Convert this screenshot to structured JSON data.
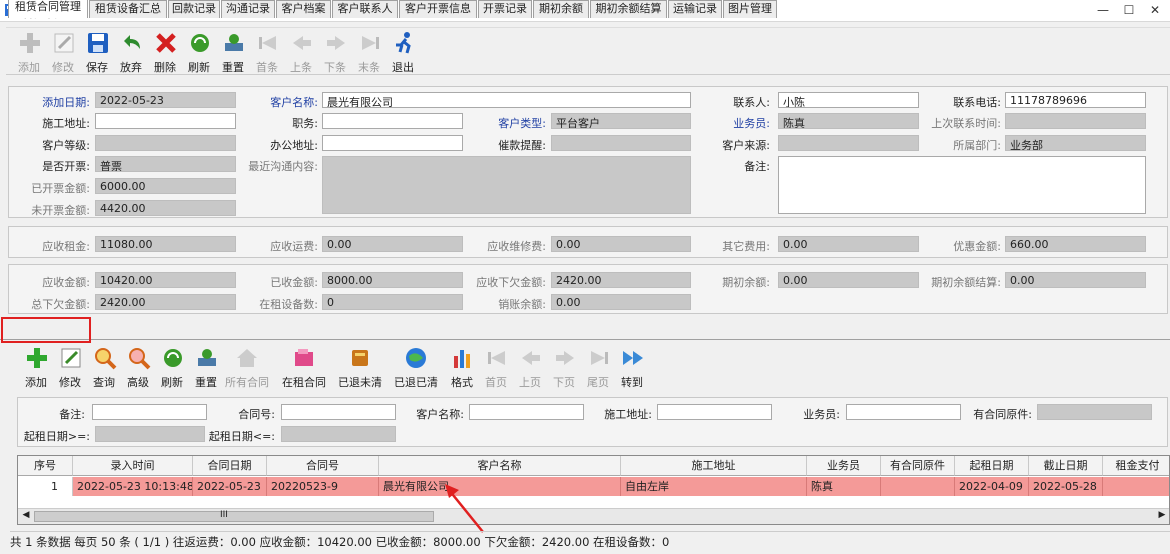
{
  "window": {
    "title": "客户管理",
    "min": "—",
    "max": "☐",
    "close": "✕"
  },
  "toolbar": {
    "add": "添加",
    "edit": "修改",
    "save": "保存",
    "undo": "放弃",
    "del": "删除",
    "refresh": "刷新",
    "reset": "重置",
    "first": "首条",
    "prev": "上条",
    "next": "下条",
    "last": "末条",
    "exit": "退出"
  },
  "form": {
    "add_date_l": "添加日期:",
    "add_date": "2022-05-23",
    "cust_name_l": "客户名称:",
    "cust_name": "晨光有限公司",
    "contact_l": "联系人:",
    "contact": "小陈",
    "phone_l": "联系电话:",
    "phone": "11178789696",
    "site_l": "施工地址:",
    "site": "",
    "title_l": "职务:",
    "title": "",
    "cust_type_l": "客户类型:",
    "cust_type": "平台客户",
    "sales_l": "业务员:",
    "sales": "陈真",
    "last_contact_l": "上次联系时间:",
    "last_contact": "",
    "level_l": "客户等级:",
    "level": "",
    "office_l": "办公地址:",
    "office": "",
    "remind_l": "催款提醒:",
    "remind": "",
    "source_l": "客户来源:",
    "source": "",
    "dept_l": "所属部门:",
    "dept": "业务部",
    "invoice_l": "是否开票:",
    "invoice": "普票",
    "recent_l": "最近沟通内容:",
    "recent": "",
    "remark_l": "备注:",
    "remark": "",
    "invoiced_l": "已开票金额:",
    "invoiced": "6000.00",
    "uninvoiced_l": "未开票金额:",
    "uninvoiced": "4420.00"
  },
  "fees": {
    "rent_l": "应收租金:",
    "rent": "11080.00",
    "freight_l": "应收运费:",
    "freight": "0.00",
    "repair_l": "应收维修费:",
    "repair": "0.00",
    "other_l": "其它费用:",
    "other": "0.00",
    "discount_l": "优惠金额:",
    "discount": "660.00"
  },
  "totals": {
    "due_l": "应收金额:",
    "due": "10420.00",
    "recv_l": "已收金额:",
    "recv": "8000.00",
    "owe_l": "应收下欠金额:",
    "owe": "2420.00",
    "init_l": "期初余额:",
    "init": "0.00",
    "init_settle_l": "期初余额结算:",
    "init_settle": "0.00",
    "total_owe_l": "总下欠金额:",
    "total_owe": "2420.00",
    "equip_l": "在租设备数:",
    "equip": "0",
    "writeoff_l": "销账余额:",
    "writeoff": "0.00"
  },
  "tabs": [
    "租赁合同管理",
    "租赁设备汇总",
    "回款记录",
    "沟通记录",
    "客户档案",
    "客户联系人",
    "客户开票信息",
    "开票记录",
    "期初余额",
    "期初余额结算",
    "运输记录",
    "图片管理"
  ],
  "subtoolbar": {
    "add": "添加",
    "edit": "修改",
    "query": "查询",
    "adv": "高级",
    "refresh": "刷新",
    "reset": "重置",
    "all": "所有合同",
    "renting": "在租合同",
    "ret_unclear": "已退未清",
    "ret_clear": "已退已清",
    "format": "格式",
    "first": "首页",
    "prev": "上页",
    "next": "下页",
    "last": "尾页",
    "goto": "转到"
  },
  "filter": {
    "remark_l": "备注:",
    "contract_no_l": "合同号:",
    "cust_name_l": "客户名称:",
    "site_l": "施工地址:",
    "sales_l": "业务员:",
    "has_orig_l": "有合同原件:",
    "start_ge_l": "起租日期>=:",
    "start_le_l": "起租日期<=:"
  },
  "grid": {
    "headers": [
      "序号",
      "录入时间",
      "合同日期",
      "合同号",
      "客户名称",
      "施工地址",
      "业务员",
      "有合同原件",
      "起租日期",
      "截止日期",
      "租金支付"
    ],
    "row": [
      "1",
      "2022-05-23 10:13:48",
      "2022-05-23",
      "20220523-9",
      "晨光有限公司",
      "自由左岸",
      "陈真",
      "",
      "2022-04-09",
      "2022-05-28",
      ""
    ],
    "scroll_mark": "III"
  },
  "status": "共 1 条数据  每页 50 条 ( 1/1 )  往返运费：0.00  应收金额：10420.00  已收金额：8000.00  下欠金额：2420.00  在租设备数：0",
  "colors": {
    "highlight_red": "#e02020",
    "row_pink": "#f49a98",
    "label_blue": "#1f3fa3"
  }
}
